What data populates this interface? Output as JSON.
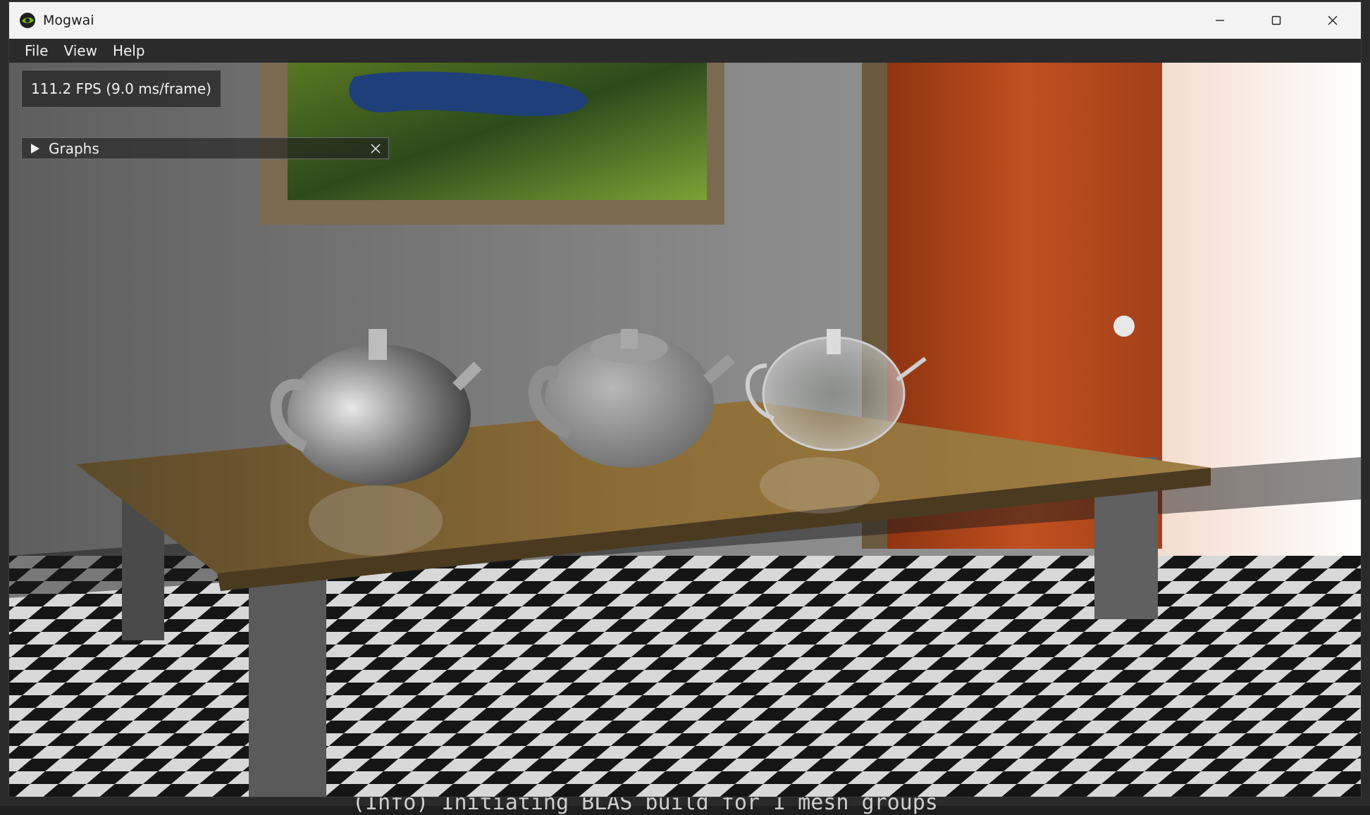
{
  "window": {
    "title": "Mogwai"
  },
  "menu": {
    "items": [
      "File",
      "View",
      "Help"
    ]
  },
  "overlay": {
    "fps_text": "111.2 FPS (9.0 ms/frame)",
    "graphs_label": "Graphs"
  },
  "console": {
    "line": "(Info) Initiating BLAS build for 1 mesh groups"
  },
  "colors": {
    "titlebar": "#f3f3f3",
    "menubar": "#2b2b2b",
    "door": "#b8461c",
    "table": "#8a6a34",
    "wall": "#8f8f8f"
  },
  "icons": {
    "app": "nvidia-eye-icon",
    "minimize": "minimize-icon",
    "maximize": "maximize-icon",
    "close": "close-icon",
    "graphs_expand": "triangle-right-icon",
    "graphs_close": "close-icon"
  }
}
